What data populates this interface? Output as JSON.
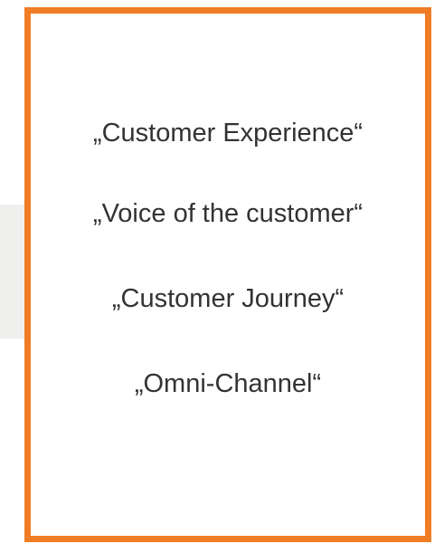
{
  "colors": {
    "frame_border": "#f07d26",
    "text": "#333333",
    "background_panel": "#efefed"
  },
  "terms": [
    {
      "text": "„Customer Experience“"
    },
    {
      "text": "„Voice of the customer“"
    },
    {
      "text": "„Customer Journey“"
    },
    {
      "text": "„Omni-Channel“"
    }
  ]
}
